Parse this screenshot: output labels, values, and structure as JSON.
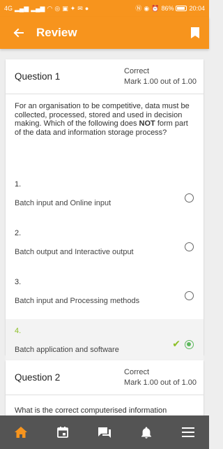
{
  "status_bar": {
    "signal_left": "4G",
    "battery_percent": "86%",
    "time": "20:04"
  },
  "app_bar": {
    "title": "Review",
    "back_icon": "back-arrow-icon",
    "bookmark_icon": "bookmark-icon"
  },
  "questions": [
    {
      "title": "Question 1",
      "status": "Correct",
      "mark": "Mark 1.00 out of 1.00",
      "text_before": "For an organisation to be competitive, data must be collected, processed, stored and used in decision making. Which of the following does ",
      "text_bold": "NOT",
      "text_after": " form part of the data and information storage process?",
      "answers": [
        {
          "number": "1.",
          "label": "Batch input and Online input",
          "selected": false
        },
        {
          "number": "2.",
          "label": "Batch output and Interactive output",
          "selected": false
        },
        {
          "number": "3.",
          "label": " Batch input and Processing methods",
          "selected": false
        },
        {
          "number": "4.",
          "label": "Batch application and software",
          "selected": true,
          "correct": true
        }
      ]
    },
    {
      "title": "Question 2",
      "status": "Correct",
      "mark": "Mark 1.00 out of 1.00",
      "text_before": "What is the correct computerised information"
    }
  ],
  "bottom_nav": {
    "items": [
      "home-icon",
      "calendar-icon",
      "messages-icon",
      "notifications-icon",
      "menu-icon"
    ],
    "active_color": "#f7941d",
    "inactive_color": "#ffffff"
  },
  "colors": {
    "accent": "#f7941d",
    "correct_green": "#8cbf26",
    "radio_green": "#5cb85c"
  }
}
